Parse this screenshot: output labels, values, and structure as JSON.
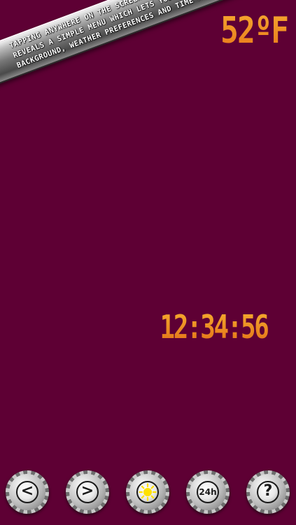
{
  "hint": {
    "lines": "TAPPING ANYWHERE ON THE SCREEN\nREVEALS A SIMPLE MENU WHICH LETS YOU CHANGE\nBACKGROUND, WEATHER PREFERENCES AND TIME MODE."
  },
  "weather": {
    "temperature": "52ºF"
  },
  "clock": {
    "time": "12:34:56"
  },
  "toolbar": {
    "prev_glyph": "<",
    "next_glyph": ">",
    "mode_24h_label": "24h",
    "help_glyph": "?"
  },
  "colors": {
    "background": "#5e0034",
    "accent_orange": "#f39a1e",
    "sun_yellow": "#ffe100"
  }
}
